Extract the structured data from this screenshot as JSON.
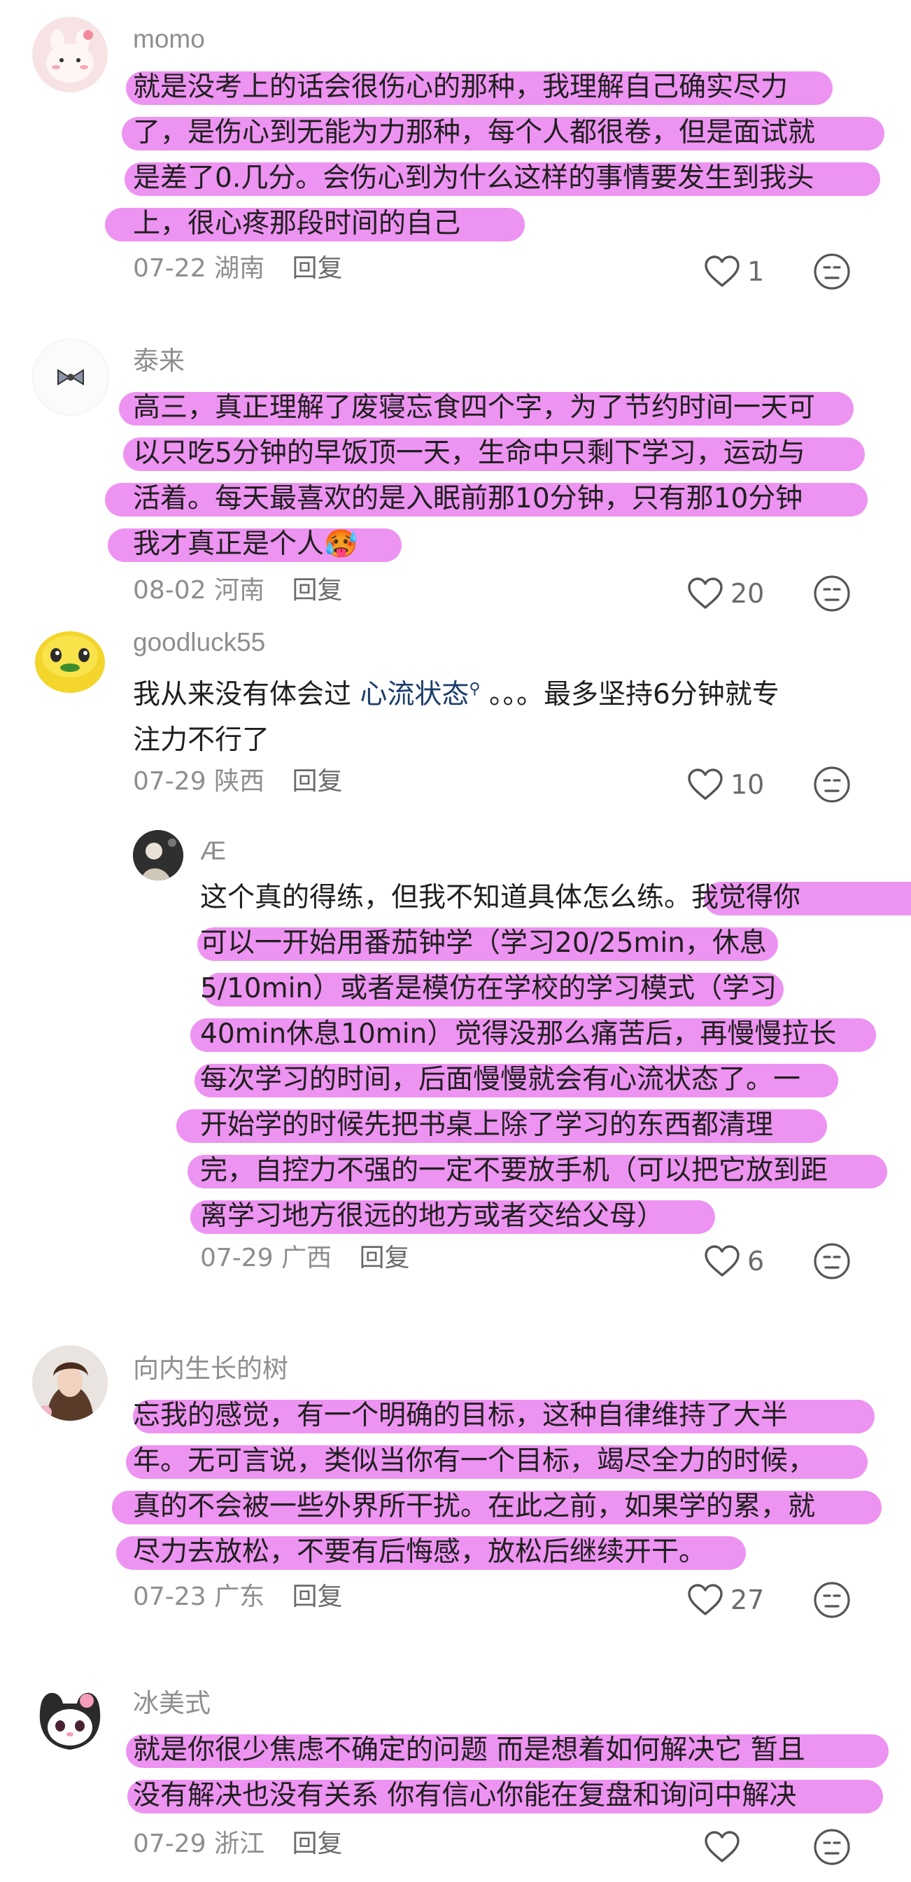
{
  "comments": [
    {
      "name": "momo",
      "lines": [
        "就是没考上的话会很伤心的那种，我理解自己确实尽力",
        "了，是伤心到无能为力那种，每个人都很卷，但是面试就",
        "是差了0.几分。会伤心到为什么这样的事情要发生到我头",
        "上，很心疼那段时间的自己"
      ],
      "date": "07-22",
      "location": "湖南",
      "reply": "回复",
      "likes": "1"
    },
    {
      "name": "泰来",
      "lines": [
        "高三，真正理解了废寝忘食四个字，为了节约时间一天可",
        "以只吃5分钟的早饭顶一天，生命中只剩下学习，运动与",
        "活着。每天最喜欢的是入眠前那10分钟，只有那10分钟",
        "我才真正是个人"
      ],
      "emoji": "🥵",
      "date": "08-02",
      "location": "河南",
      "reply": "回复",
      "likes": "20"
    },
    {
      "name": "goodluck55",
      "line1_pre": "我从来没有体会过 ",
      "line1_link": "心流状态",
      "line1_post": " 。。。最多坚持6分钟就专",
      "line2": "注力不行了",
      "date": "07-29",
      "location": "陕西",
      "reply": "回复",
      "likes": "10"
    },
    {
      "name": "Æ",
      "lines": [
        "这个真的得练，但我不知道具体怎么练。我觉得你",
        "可以一开始用番茄钟学（学习20/25min，休息",
        "5/10min）或者是模仿在学校的学习模式（学习",
        "40min休息10min）觉得没那么痛苦后，再慢慢拉长",
        "每次学习的时间，后面慢慢就会有心流状态了。一",
        "开始学的时候先把书桌上除了学习的东西都清理",
        "完，自控力不强的一定不要放手机（可以把它放到距",
        "离学习地方很远的地方或者交给父母）"
      ],
      "date": "07-29",
      "location": "广西",
      "reply": "回复",
      "likes": "6"
    },
    {
      "name": "向内生长的树",
      "lines": [
        "忘我的感觉，有一个明确的目标，这种自律维持了大半",
        "年。无可言说，类似当你有一个目标，竭尽全力的时候，",
        "真的不会被一些外界所干扰。在此之前，如果学的累，就",
        "尽力去放松，不要有后悔感，放松后继续开干。"
      ],
      "date": "07-23",
      "location": "广东",
      "reply": "回复",
      "likes": "27"
    },
    {
      "name": "冰美式",
      "lines": [
        "就是你很少焦虑不确定的问题 而是想着如何解决它 暂且",
        "没有解决也没有关系 你有信心你能在复盘和询问中解决"
      ],
      "date": "07-29",
      "location": "浙江",
      "reply": "回复",
      "likes": ""
    }
  ],
  "colors": {
    "highlight": "#e250e8",
    "meta": "#8e8e8e",
    "link": "#1b3e6b"
  },
  "icons": [
    "heart-outline-icon",
    "neutral-face-icon",
    "search-icon"
  ]
}
